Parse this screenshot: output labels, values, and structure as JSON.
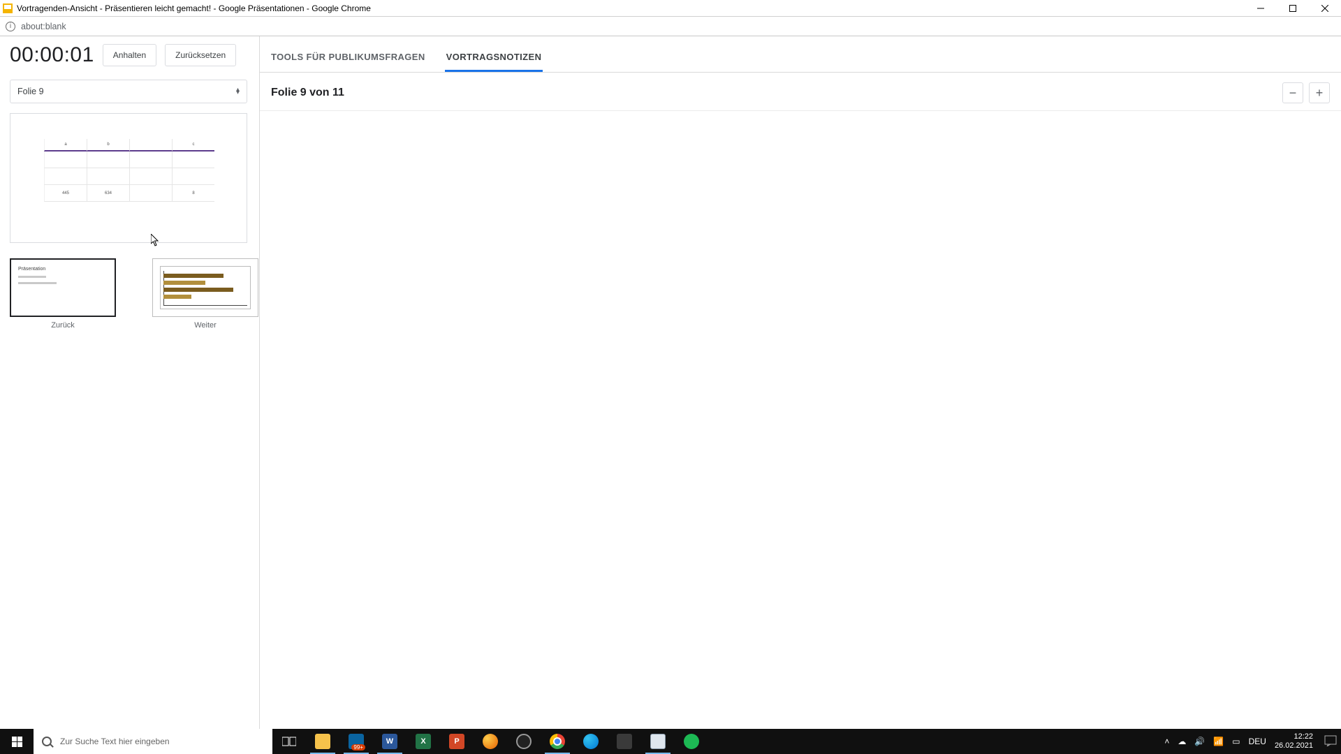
{
  "window": {
    "title": "Vortragenden-Ansicht - Präsentieren leicht gemacht! - Google Präsentationen - Google Chrome"
  },
  "address": {
    "url": "about:blank"
  },
  "presenter": {
    "timer": "00:00:01",
    "pause_label": "Anhalten",
    "reset_label": "Zurücksetzen",
    "slide_selector": "Folie 9",
    "prev_label": "Zurück",
    "next_label": "Weiter"
  },
  "tabs": {
    "audience": "TOOLS FÜR PUBLIKUMSFRAGEN",
    "notes": "VORTRAGSNOTIZEN"
  },
  "notes": {
    "heading": "Folie 9 von 11",
    "zoom_out": "−",
    "zoom_in": "+"
  },
  "taskbar": {
    "search_placeholder": "Zur Suche Text hier eingeben",
    "lang": "DEU",
    "time": "12:22",
    "date": "26.02.2021"
  }
}
